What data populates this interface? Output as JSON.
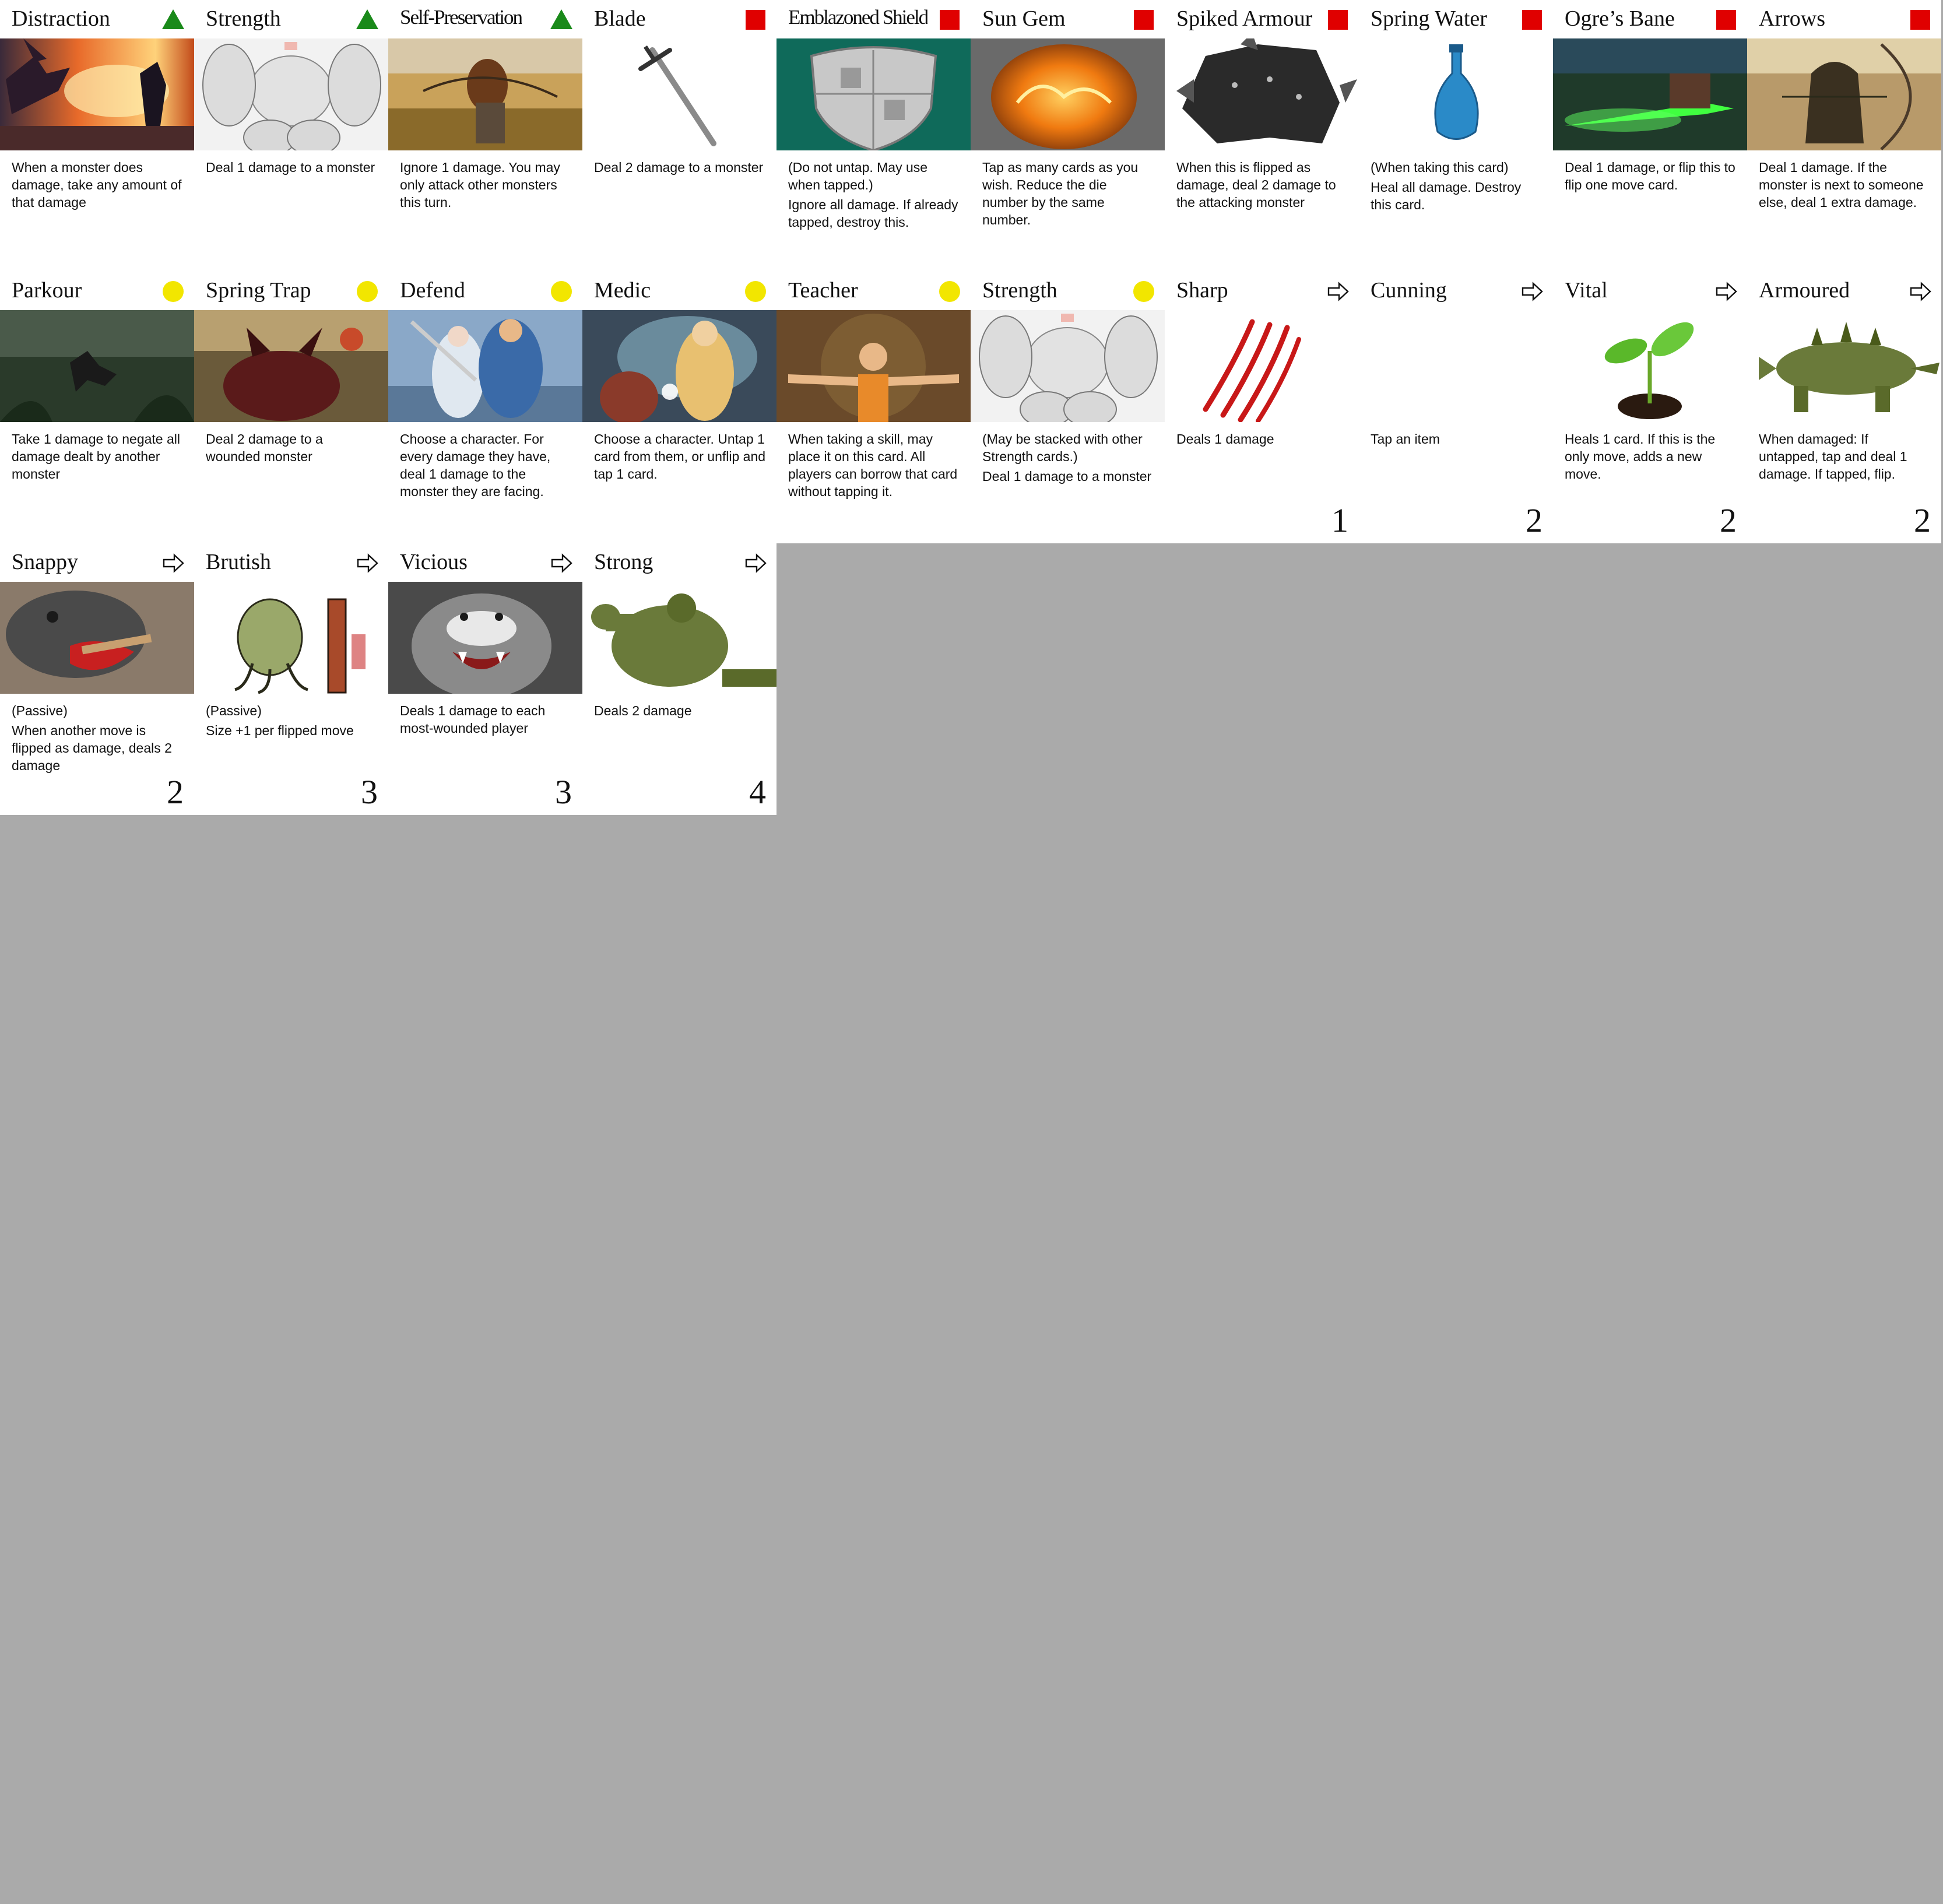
{
  "cards": [
    {
      "title": "Distraction",
      "symbol": "triangle",
      "art": "dragon-battle",
      "lines": [
        "When a monster does damage, take any amount of that damage"
      ]
    },
    {
      "title": "Strength",
      "symbol": "triangle",
      "art": "muscle-sketch",
      "lines": [
        "Deal 1 damage to a monster"
      ]
    },
    {
      "title": "Self-Preservation",
      "symbol": "triangle",
      "art": "archer-field",
      "lines": [
        "Ignore 1 damage. You may only attack other monsters this turn."
      ]
    },
    {
      "title": "Blade",
      "symbol": "square",
      "art": "sword",
      "lines": [
        "Deal 2 damage to a monster"
      ]
    },
    {
      "title": "Emblazoned Shield",
      "symbol": "square",
      "art": "shield",
      "lines": [
        "(Do not untap. May use when tapped.)",
        "Ignore all damage. If already tapped, destroy this."
      ]
    },
    {
      "title": "Sun Gem",
      "symbol": "square",
      "art": "fire-gem",
      "lines": [
        "Tap as many cards as you wish. Reduce the die number by the same number."
      ]
    },
    {
      "title": "Spiked Armour",
      "symbol": "square",
      "art": "spiked-armour",
      "lines": [
        "When this is flipped as damage, deal 2 damage to the attacking monster"
      ]
    },
    {
      "title": "Spring Water",
      "symbol": "square",
      "art": "bottle",
      "lines": [
        "(When taking this card)",
        "Heal all damage. Destroy this card."
      ]
    },
    {
      "title": "Ogre’s Bane",
      "symbol": "square",
      "art": "green-dagger",
      "lines": [
        "Deal 1 damage, or flip this to flip one move card."
      ]
    },
    {
      "title": "Arrows",
      "symbol": "square",
      "art": "hooded-archer",
      "lines": [
        "Deal 1 damage. If the monster is next to someone else, deal 1 extra damage."
      ]
    },
    {
      "title": "Parkour",
      "symbol": "circle",
      "art": "jungle-leap",
      "lines": [
        "Take 1 damage to negate all damage dealt by another monster"
      ]
    },
    {
      "title": "Spring Trap",
      "symbol": "circle",
      "art": "red-beast",
      "lines": [
        "Deal 2 damage to a wounded monster"
      ]
    },
    {
      "title": "Defend",
      "symbol": "circle",
      "art": "warriors-blue",
      "lines": [
        "Choose a character. For every damage they have, deal 1 damage to the monster they are facing."
      ]
    },
    {
      "title": "Medic",
      "symbol": "circle",
      "art": "healer-glow",
      "lines": [
        "Choose a character. Untap 1 card from them, or unflip and tap 1 card."
      ]
    },
    {
      "title": "Teacher",
      "symbol": "circle",
      "art": "monk-arms",
      "lines": [
        "When taking a skill, may place it on this card. All players can borrow that card without tapping it."
      ]
    },
    {
      "title": "Strength",
      "symbol": "circle",
      "art": "muscle-sketch",
      "lines": [
        "(May be stacked with other Strength cards.)",
        "Deal 1 damage to a monster"
      ]
    },
    {
      "title": "Sharp",
      "symbol": "arrow",
      "art": "claw-marks",
      "lines": [
        "Deals 1 damage"
      ],
      "cost": "1"
    },
    {
      "title": "Cunning",
      "symbol": "arrow",
      "art": "blank",
      "lines": [
        "Tap an item"
      ],
      "cost": "2"
    },
    {
      "title": "Vital",
      "symbol": "arrow",
      "art": "sprout",
      "lines": [
        "Heals 1 card. If this is the only move, adds a new move."
      ],
      "cost": "2"
    },
    {
      "title": "Armoured",
      "symbol": "arrow",
      "art": "ankylosaur",
      "lines": [
        "When damaged: If untapped, tap and deal 1 damage. If tapped, flip."
      ],
      "cost": "2"
    },
    {
      "title": "Snappy",
      "symbol": "arrow",
      "art": "turtle",
      "lines": [
        "(Passive)",
        "When another move is flipped as damage, deals 2 damage"
      ],
      "cost": "2"
    },
    {
      "title": "Brutish",
      "symbol": "arrow",
      "art": "tentacle-brute",
      "lines": [
        "(Passive)",
        "Size +1 per flipped move"
      ],
      "cost": "3"
    },
    {
      "title": "Vicious",
      "symbol": "arrow",
      "art": "snarling-wolf",
      "lines": [
        "Deals 1 damage to each most-wounded player"
      ],
      "cost": "3"
    },
    {
      "title": "Strong",
      "symbol": "arrow",
      "art": "green-giant",
      "lines": [
        "Deals 2 damage"
      ],
      "cost": "4"
    }
  ],
  "colors": {
    "triangle": "#1a8a1a",
    "square": "#e00000",
    "circle": "#f2e600",
    "background": "#aaaaaa"
  }
}
